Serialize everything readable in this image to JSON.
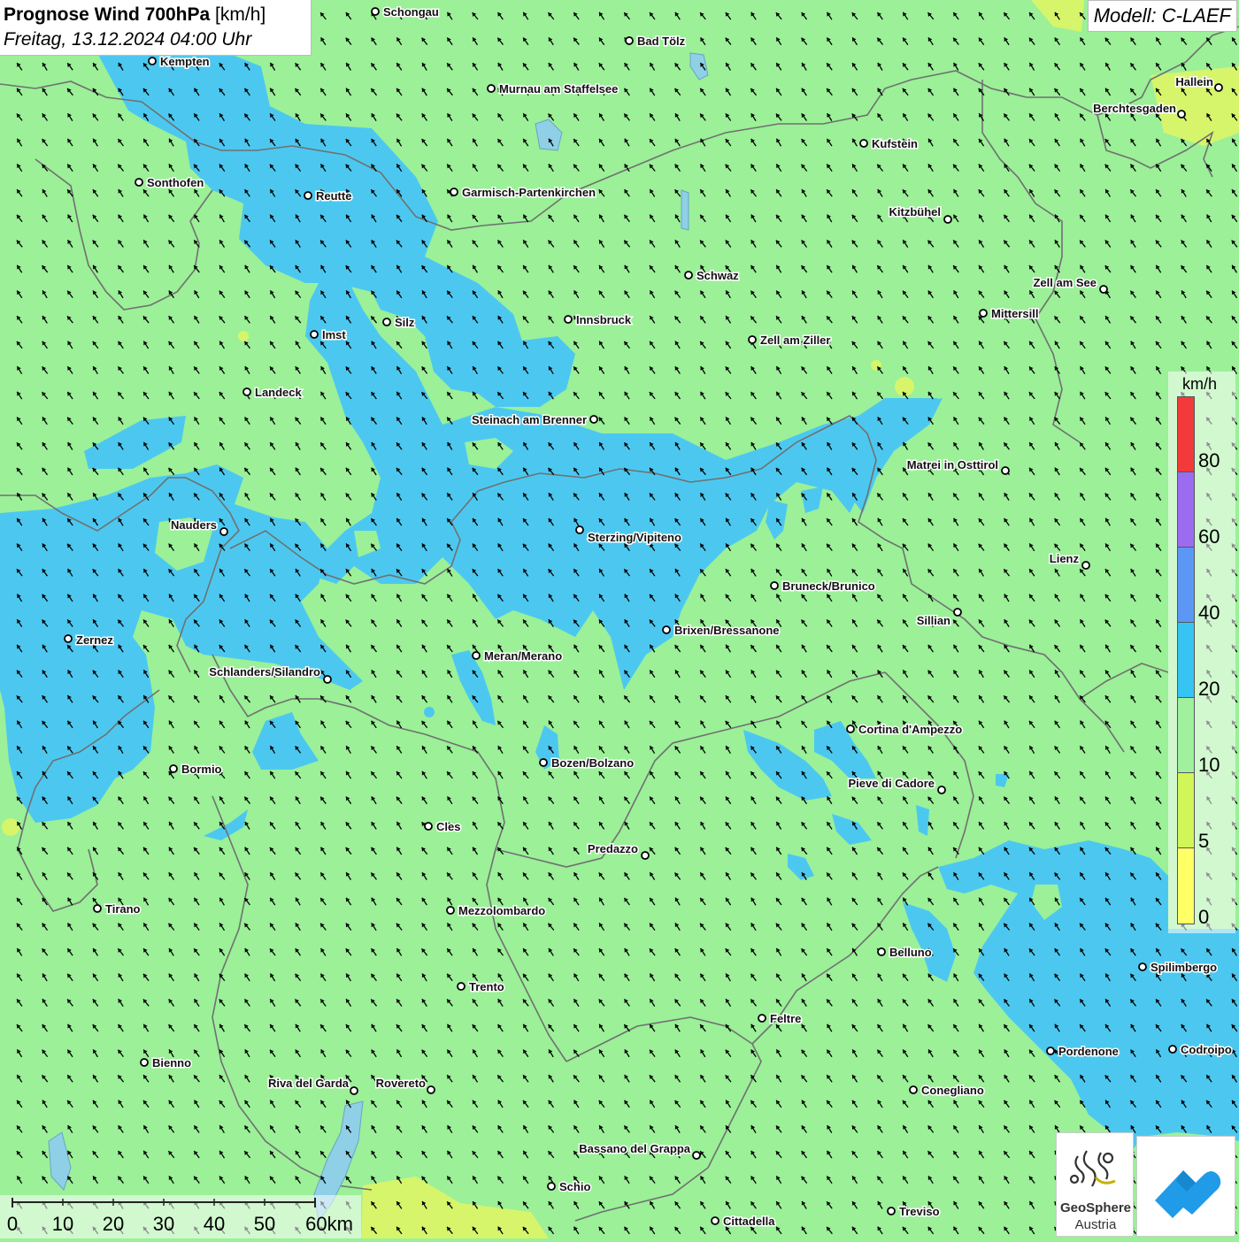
{
  "header": {
    "title_bold": "Prognose Wind 700hPa",
    "title_unit": " [km/h]",
    "subtitle": "Freitag, 13.12.2024 04:00 Uhr"
  },
  "model": "Modell: C-LAEF",
  "legend": {
    "unit": "km/h",
    "ticks": [
      "80",
      "60",
      "40",
      "20",
      "10",
      "5",
      "0"
    ],
    "colors": [
      "#f23a3a",
      "#9b6cf0",
      "#5c97f5",
      "#36c4f2",
      "#a0f0a0",
      "#d2f55a",
      "#ffff66"
    ]
  },
  "scale": {
    "labels": [
      "0",
      "10",
      "20",
      "30",
      "40",
      "50",
      "60km"
    ]
  },
  "colors": {
    "background": "#9bf098",
    "wind_20_40": "#4cc8f0",
    "wind_5_10": "#d6f56b",
    "border": "#707070",
    "arrow": "#000000"
  },
  "logos": {
    "geosphere_line1": "GeoSphere",
    "geosphere_line2": "Austria"
  },
  "places": [
    "Schongau",
    "Bad Tölz",
    "Kempten",
    "Murnau am Staffelsee",
    "Hallein",
    "Berchtesgaden",
    "Kufstein",
    "Sonthofen",
    "Reutte",
    "Garmisch-Partenkirchen",
    "Kitzbühel",
    "Schwaz",
    "Zell am See",
    "Mittersill",
    "Imst",
    "Silz",
    "Innsbruck",
    "Zell am Ziller",
    "Landeck",
    "Steinach am Brenner",
    "Matrei in Osttirol",
    "Nauders",
    "Sterzing/Vipiteno",
    "Lienz",
    "Bruneck/Brunico",
    "Sillian",
    "Zernez",
    "Brixen/Bressanone",
    "Meran/Merano",
    "Schlanders/Silandro",
    "Cortina d'Ampezzo",
    "Bozen/Bolzano",
    "Bormio",
    "Pieve di Cadore",
    "Cles",
    "Predazzo",
    "Tirano",
    "Mezzolombardo",
    "Belluno",
    "Spilimbergo",
    "Trento",
    "Feltre",
    "Pordenone",
    "Codroipo",
    "Bienno",
    "Riva del Garda",
    "Rovereto",
    "Conegliano",
    "Bassano del Grappa",
    "Schio",
    "Treviso",
    "Cittadella"
  ]
}
